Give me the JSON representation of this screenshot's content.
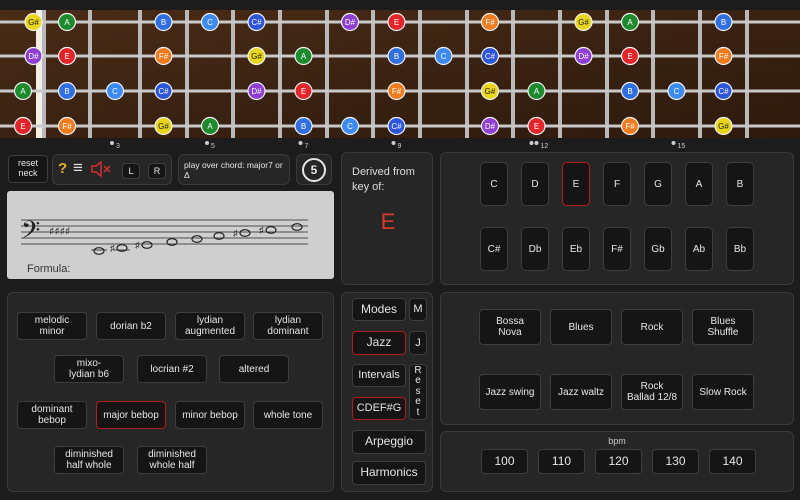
{
  "fretboard": {
    "fret_marker_numbers": [
      "3",
      "5",
      "7",
      "9",
      "12",
      "15"
    ],
    "strings": [
      {
        "notes": [
          "G#",
          "A",
          "B",
          "C",
          "C#",
          "D#",
          "E",
          "F#",
          "G#",
          "A",
          "B"
        ],
        "frets": [
          1,
          2,
          4,
          5,
          6,
          8,
          9,
          11,
          13,
          14,
          16
        ]
      },
      {
        "notes": [
          "D#",
          "E",
          "F#",
          "G#",
          "A",
          "B",
          "C",
          "C#",
          "D#",
          "E",
          "F#"
        ],
        "frets": [
          1,
          2,
          4,
          6,
          7,
          9,
          10,
          11,
          13,
          14,
          16
        ]
      },
      {
        "notes": [
          "A",
          "B",
          "C",
          "C#",
          "D#",
          "E",
          "F#",
          "G#",
          "A",
          "B",
          "C",
          "C#"
        ],
        "frets": [
          0,
          2,
          3,
          4,
          6,
          7,
          9,
          11,
          12,
          14,
          15,
          16
        ]
      },
      {
        "notes": [
          "E",
          "F#",
          "G#",
          "A",
          "B",
          "C",
          "C#",
          "D#",
          "E",
          "F#",
          "G#"
        ],
        "frets": [
          0,
          2,
          4,
          5,
          7,
          8,
          9,
          11,
          12,
          14,
          16
        ]
      }
    ],
    "note_colors": {
      "A": "#1e8a2e",
      "B": "#2f6fe0",
      "C": "#3d8af0",
      "C#": "#2c55d8",
      "D#": "#8e3fd0",
      "E": "#e0262a",
      "F#": "#ef7c1f",
      "G#": "#e8d51c"
    }
  },
  "controls": {
    "reset_neck": "reset\nneck",
    "help_icon": "?",
    "menu_icon": "≡",
    "mute_icon": "🔇",
    "left_label": "L",
    "right_label": "R",
    "chord_info": "play over chord: major7 or Δ",
    "circle_of_fifths": "5"
  },
  "staff": {
    "formula_label": "Formula:",
    "formula": [
      "1",
      "1",
      "½",
      "1",
      "½",
      "½",
      "1",
      "½"
    ],
    "notes": [
      "E",
      "F#",
      "G#",
      "A",
      "B",
      "C",
      "C#",
      "D#",
      "E"
    ]
  },
  "derived": {
    "label": "Derived from key of:",
    "key": "E"
  },
  "keys": {
    "row1": [
      "C",
      "D",
      "E",
      "F",
      "G",
      "A",
      "B"
    ],
    "row2": [
      "C#",
      "Db",
      "Eb",
      "F#",
      "Gb",
      "Ab",
      "Bb"
    ],
    "selected": "E"
  },
  "scales": {
    "items": [
      "melodic\nminor",
      "dorian b2",
      "lydian\naugmented",
      "lydian\ndominant",
      "mixo-\nlydian b6",
      "locrian #2",
      "altered",
      "dominant\nbebop",
      "major bebop",
      "minor bebop",
      "whole tone",
      "diminished\nhalf whole",
      "diminished\nwhole half"
    ],
    "selected": "major bebop"
  },
  "modes_panel": {
    "modes": "Modes",
    "m": "M",
    "jazz": "Jazz",
    "j": "J",
    "intervals": "Intervals",
    "reset": "R\ne\ns\ne\nt",
    "cdef": "CDEF#G",
    "arpeggio": "Arpeggio",
    "harmonics": "Harmonics"
  },
  "styles": {
    "items": [
      "Bossa\nNova",
      "Blues",
      "Rock",
      "Blues\nShuffle",
      "Jazz swing",
      "Jazz waltz",
      "Rock\nBallad 12/8",
      "Slow Rock"
    ]
  },
  "tempo": {
    "label": "bpm",
    "values": [
      "100",
      "110",
      "120",
      "130",
      "140"
    ]
  }
}
